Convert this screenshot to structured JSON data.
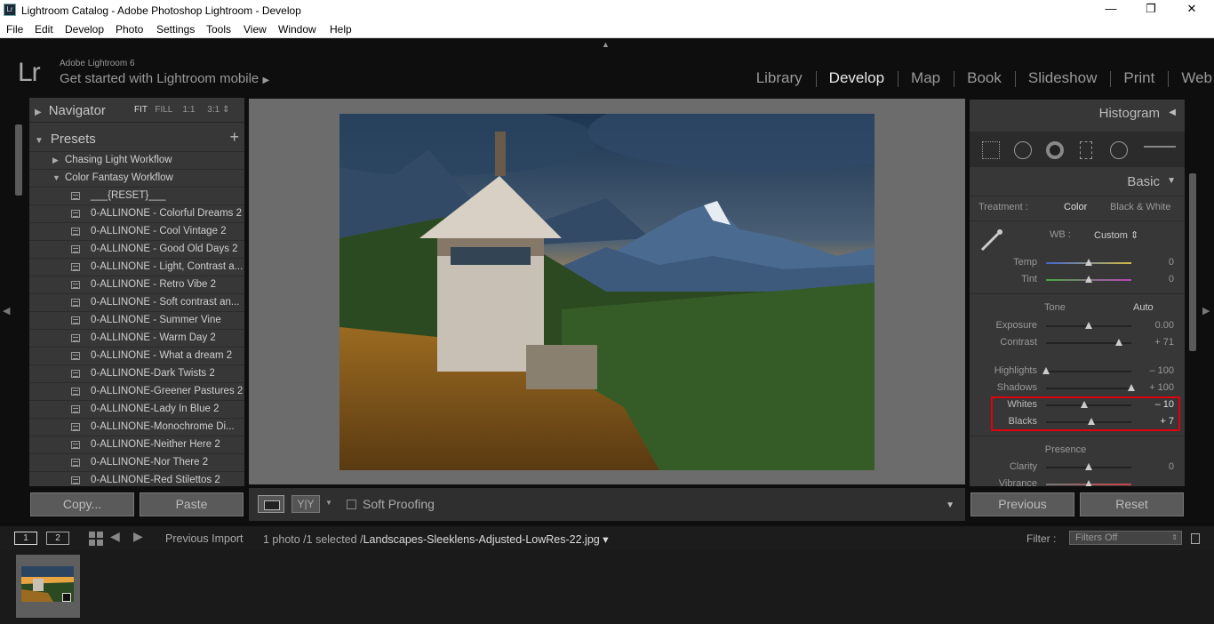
{
  "window": {
    "title": "Lightroom Catalog - Adobe Photoshop Lightroom - Develop",
    "minimize": "—",
    "restore": "❐",
    "close": "✕"
  },
  "menu": [
    "File",
    "Edit",
    "Develop",
    "Photo",
    "Settings",
    "Tools",
    "View",
    "Window",
    "Help"
  ],
  "identity": {
    "logo": "Lr",
    "brand": "Adobe Lightroom 6",
    "mobile": "Get started with Lightroom mobile"
  },
  "modules": [
    "Library",
    "Develop",
    "Map",
    "Book",
    "Slideshow",
    "Print",
    "Web"
  ],
  "active_module": "Develop",
  "navigator": {
    "title": "Navigator",
    "zoom": [
      "FIT",
      "FILL",
      "1:1",
      "3:1"
    ]
  },
  "presets": {
    "title": "Presets",
    "folders": [
      "Chasing Light Workflow",
      "Color Fantasy Workflow"
    ],
    "items": [
      "___{RESET}___",
      "0-ALLINONE - Colorful Dreams 2",
      "0-ALLINONE - Cool Vintage 2",
      "0-ALLINONE - Good Old Days 2",
      "0-ALLINONE - Light, Contrast a...",
      "0-ALLINONE - Retro Vibe 2",
      "0-ALLINONE - Soft contrast an...",
      "0-ALLINONE - Summer Vine",
      "0-ALLINONE - Warm Day 2",
      "0-ALLINONE - What a dream 2",
      "0-ALLINONE-Dark Twists 2",
      "0-ALLINONE-Greener Pastures 2",
      "0-ALLINONE-Lady In Blue 2",
      "0-ALLINONE-Monochrome Di...",
      "0-ALLINONE-Neither Here 2",
      "0-ALLINONE-Nor There 2",
      "0-ALLINONE-Red Stilettos 2"
    ]
  },
  "left_buttons": {
    "copy": "Copy...",
    "paste": "Paste"
  },
  "toolbar": {
    "compare": "Y|Y",
    "soft_proofing": "Soft Proofing"
  },
  "right": {
    "histogram": "Histogram",
    "basic": "Basic",
    "treatment_label": "Treatment :",
    "treatment_color": "Color",
    "treatment_bw": "Black & White",
    "wb_label": "WB :",
    "wb_value": "Custom ⇕",
    "tone_label": "Tone",
    "auto": "Auto",
    "presence_label": "Presence",
    "sliders": {
      "temp": {
        "label": "Temp",
        "value": "0",
        "pos": 0.5
      },
      "tint": {
        "label": "Tint",
        "value": "0",
        "pos": 0.5
      },
      "exposure": {
        "label": "Exposure",
        "value": "0.00",
        "pos": 0.5
      },
      "contrast": {
        "label": "Contrast",
        "value": "+ 71",
        "pos": 0.855
      },
      "highlights": {
        "label": "Highlights",
        "value": "– 100",
        "pos": 0.0
      },
      "shadows": {
        "label": "Shadows",
        "value": "+ 100",
        "pos": 1.0
      },
      "whites": {
        "label": "Whites",
        "value": "– 10",
        "pos": 0.45
      },
      "blacks": {
        "label": "Blacks",
        "value": "+ 7",
        "pos": 0.535
      },
      "clarity": {
        "label": "Clarity",
        "value": "0",
        "pos": 0.5
      },
      "vibrance": {
        "label": "Vibrance",
        "value": "",
        "pos": 0.5
      }
    }
  },
  "right_buttons": {
    "previous": "Previous",
    "reset": "Reset"
  },
  "filmbar": {
    "screen1": "1",
    "screen2": "2",
    "source": "Previous Import",
    "count": "1 photo /1 selected /",
    "filename": "Landscapes-Sleeklens-Adjusted-LowRes-22.jpg ▾",
    "filter_label": "Filter :",
    "filter_value": "Filters Off"
  },
  "colors": {
    "accent_red": "#e00010",
    "panel": "#373737",
    "center": "#6c6c6c"
  }
}
